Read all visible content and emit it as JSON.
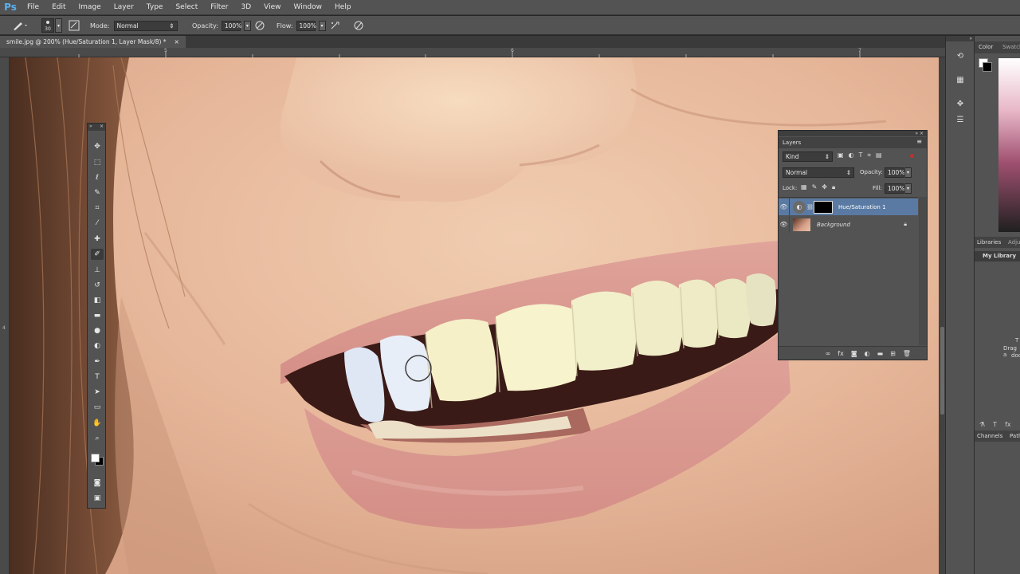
{
  "menubar": {
    "logo": "Ps",
    "items": [
      "File",
      "Edit",
      "Image",
      "Layer",
      "Type",
      "Select",
      "Filter",
      "3D",
      "View",
      "Window",
      "Help"
    ]
  },
  "options": {
    "brush_size": "30",
    "mode_label": "Mode:",
    "mode_value": "Normal",
    "opacity_label": "Opacity:",
    "opacity_value": "100%",
    "flow_label": "Flow:",
    "flow_value": "100%"
  },
  "document": {
    "tab_title": "smile.jpg @ 200% (Hue/Saturation 1, Layer Mask/8) *",
    "close": "×"
  },
  "ruler": {
    "h_labels": [
      "5",
      "6",
      "7"
    ],
    "v_labels": [
      "4"
    ]
  },
  "layers_panel": {
    "title": "Layers",
    "filter_kind": "Kind",
    "blend_mode": "Normal",
    "opacity_label": "Opacity:",
    "opacity_value": "100%",
    "lock_label": "Lock:",
    "fill_label": "Fill:",
    "fill_value": "100%",
    "layers": [
      {
        "name": "Hue/Saturation 1",
        "selected": true
      },
      {
        "name": "Background",
        "selected": false
      }
    ]
  },
  "right_panel": {
    "color_tab": "Color",
    "swatches_tab": "Swatch",
    "libraries_tab": "Libraries",
    "adjust_tab": "Adju",
    "my_library": "My Library",
    "drag_text_1": "T",
    "drag_text_2": "Drag a",
    "drag_text_3": "doc",
    "channels_tab": "Channels",
    "paths_tab": "Path"
  },
  "colors": {
    "chrome": "#535353",
    "dark": "#282828",
    "selected_layer": "#5a7aa3",
    "skin": "#e5b89a"
  }
}
